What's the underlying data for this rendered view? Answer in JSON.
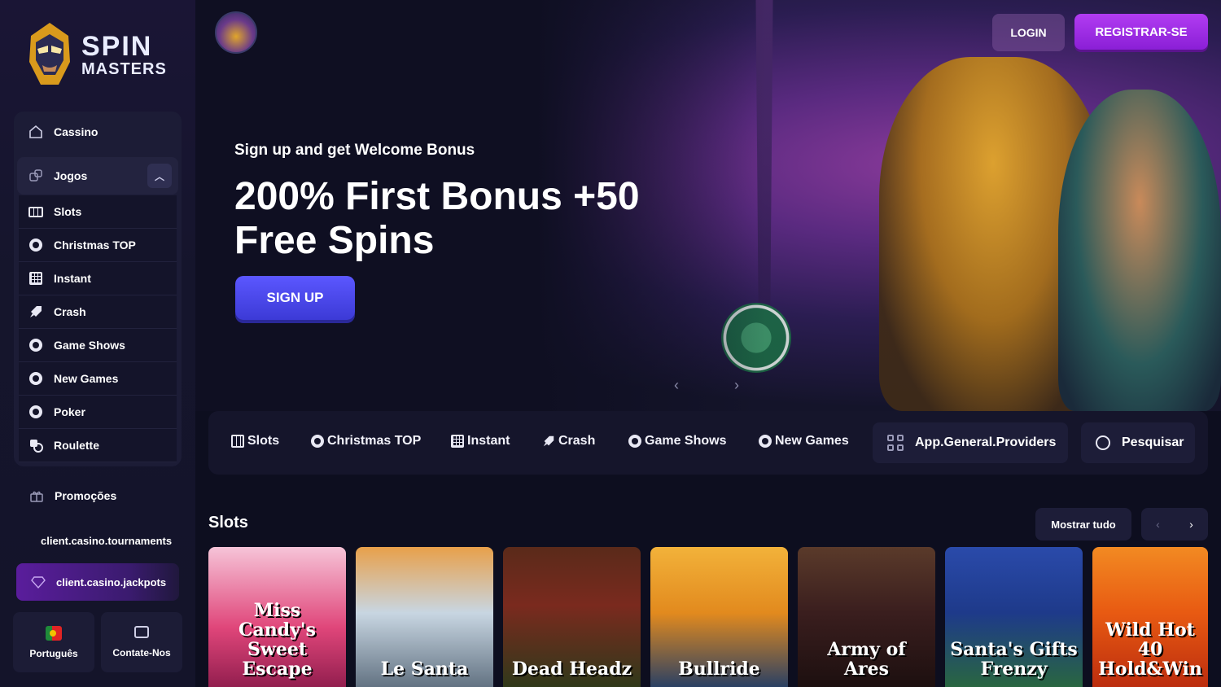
{
  "brand": {
    "line1": "SPIN",
    "line2": "MASTERS"
  },
  "sidebar": {
    "cassino": "Cassino",
    "jogos": "Jogos",
    "items": [
      {
        "label": "Slots",
        "icon": "slots-icon"
      },
      {
        "label": "Christmas TOP",
        "icon": "chip-icon"
      },
      {
        "label": "Instant",
        "icon": "grid-icon"
      },
      {
        "label": "Crash",
        "icon": "rocket-icon"
      },
      {
        "label": "Game Shows",
        "icon": "chip-icon"
      },
      {
        "label": "New Games",
        "icon": "chip-icon"
      },
      {
        "label": "Poker",
        "icon": "chip-icon"
      },
      {
        "label": "Roulette",
        "icon": "roulette-icon"
      }
    ],
    "promocoes": "Promoções",
    "tournaments": "client.casino.tournaments",
    "jackpots": "client.casino.jackpots",
    "language": "Português",
    "contact": "Contate-Nos"
  },
  "header": {
    "login": "LOGIN",
    "register": "REGISTRAR-SE"
  },
  "hero": {
    "subtitle": "Sign up and get Welcome Bonus",
    "title": "200% First Bonus +50 Free Spins",
    "cta": "SIGN UP",
    "prev": "‹",
    "next": "›"
  },
  "categories": {
    "items": [
      "Slots",
      "Christmas TOP",
      "Instant",
      "Crash",
      "Game Shows",
      "New Games"
    ],
    "providers": "App.General.Providers",
    "search": "Pesquisar"
  },
  "slots_section": {
    "title": "Slots",
    "show_all": "Mostrar tudo",
    "prev": "‹",
    "next": "›",
    "games": [
      {
        "title": "Miss Candy's Sweet Escape",
        "color": "#e0467a"
      },
      {
        "title": "Le Santa",
        "color": "#c8d6e2"
      },
      {
        "title": "Dead Headz",
        "color": "#7a2a1e"
      },
      {
        "title": "Bullride",
        "color": "#e28a1e"
      },
      {
        "title": "Army of Ares",
        "color": "#3a1e1e"
      },
      {
        "title": "Santa's Gifts Frenzy",
        "color": "#1e3a8a"
      },
      {
        "title": "Wild Hot 40 Hold&Win",
        "color": "#e85a12"
      }
    ]
  },
  "colors": {
    "accent": "#8a1fd6",
    "signup": "#4b48f0",
    "bg": "#0d0e1f"
  }
}
